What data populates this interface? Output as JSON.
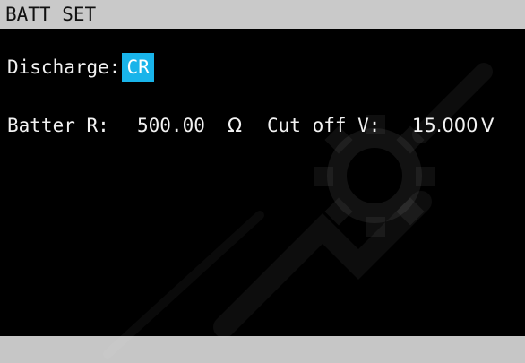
{
  "header": {
    "title": "BATT SET"
  },
  "discharge": {
    "label": "Discharge:",
    "mode": "CR"
  },
  "battery": {
    "r_label": "Batter R:",
    "r_value": "500.00",
    "r_unit": "Ω",
    "cutoff_label": "Cut off V:",
    "cutoff_value": "15.000",
    "cutoff_unit": "V"
  },
  "colors": {
    "title_bg": "#c9c9c9",
    "screen_bg": "#000000",
    "selection": "#19b4ea",
    "text": "#f2f2f2",
    "footer_bg": "#c6c6c6"
  }
}
